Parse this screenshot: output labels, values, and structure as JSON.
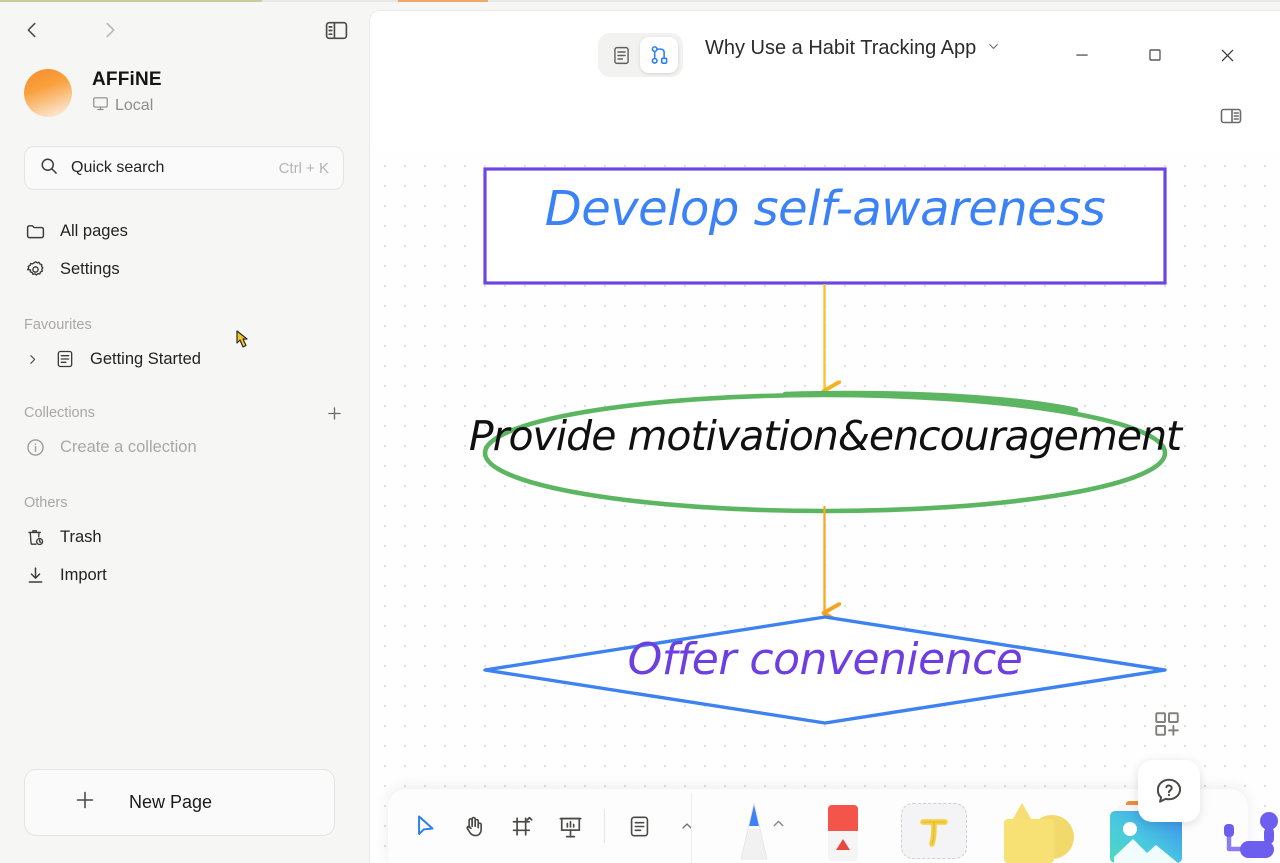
{
  "window": {
    "title": "Why Use a Habit Tracking App",
    "controls": {
      "minimize": "minimize-icon",
      "maximize": "maximize-icon",
      "close": "close-icon"
    },
    "mode_tabs": [
      {
        "name": "page-mode",
        "icon": "document-icon",
        "active": false
      },
      {
        "name": "edgeless-mode",
        "icon": "edgeless-graph-icon",
        "active": true
      }
    ]
  },
  "sidebar": {
    "nav": {
      "back": "chevron-left-icon",
      "forward": "chevron-right-icon",
      "toggle_sidebar": "sidebar-toggle-icon"
    },
    "workspace": {
      "name": "AFFiNE",
      "sync_status": "Local",
      "sync_icon": "monitor-icon"
    },
    "search": {
      "label": "Quick search",
      "shortcut": "Ctrl + K",
      "icon": "search-icon"
    },
    "items": [
      {
        "label": "All pages",
        "icon": "folder-icon"
      },
      {
        "label": "Settings",
        "icon": "gear-icon"
      }
    ],
    "favourites": {
      "title": "Favourites",
      "entries": [
        {
          "label": "Getting Started",
          "icon": "page-icon",
          "expander": "chevron-right-icon"
        }
      ]
    },
    "collections": {
      "title": "Collections",
      "add_icon": "plus-icon",
      "entries": [
        {
          "label": "Create a collection",
          "icon": "info-circle-icon"
        }
      ]
    },
    "others": {
      "title": "Others",
      "entries": [
        {
          "label": "Trash",
          "icon": "trash-clock-icon"
        },
        {
          "label": "Import",
          "icon": "import-download-icon"
        }
      ]
    },
    "new_page": {
      "label": "New Page",
      "icon": "plus-icon"
    }
  },
  "main": {
    "right_panel_toggle": "right-sidebar-toggle-icon",
    "frame_add": "add-frame-icon"
  },
  "canvas": {
    "background": "#fefefe",
    "dot_color": "#dfdfe2",
    "shapes": [
      {
        "name": "rectangle-shape",
        "type": "rectangle",
        "text": "Develop self-awareness",
        "stroke": "#6b46e5",
        "text_color": "#3b82f6",
        "fill": "#ffffff"
      },
      {
        "name": "ellipse-shape",
        "type": "ellipse",
        "text": "Provide motivation&encouragement",
        "stroke": "#5cb661",
        "text_color": "#101010",
        "fill": "#ffffff"
      },
      {
        "name": "diamond-shape",
        "type": "diamond",
        "text": "Offer convenience",
        "stroke": "#3d82ef",
        "text_color": "#6d3fe0",
        "fill": "#ffffff"
      }
    ],
    "connectors": [
      {
        "name": "connector-rect-to-ellipse",
        "color": "#fbc02d"
      },
      {
        "name": "connector-ellipse-to-diamond",
        "color": "#f9a825"
      }
    ]
  },
  "toolbar": {
    "items": [
      {
        "name": "select-tool",
        "icon": "cursor-arrow-icon",
        "active": true
      },
      {
        "name": "hand-tool",
        "icon": "hand-icon",
        "active": false
      },
      {
        "name": "frame-tool",
        "icon": "frame-icon",
        "active": false
      },
      {
        "name": "present-tool",
        "icon": "presentation-icon",
        "active": false
      },
      {
        "name": "note-tool",
        "icon": "note-document-icon",
        "active": false
      }
    ],
    "creative_tools": [
      {
        "name": "pen-tool",
        "icon": "pen-icon",
        "color": "#3b82f6"
      },
      {
        "name": "eraser-tool",
        "icon": "eraser-icon",
        "color": "#f4554a"
      },
      {
        "name": "text-tool",
        "icon": "text-T-icon",
        "color": "#f5cf42"
      },
      {
        "name": "shape-tool",
        "icon": "shapes-icon",
        "color": "#f7e174"
      },
      {
        "name": "image-tool",
        "icon": "image-icon",
        "color": "#4dd6c8"
      },
      {
        "name": "connector-tool",
        "icon": "connector-icon",
        "color": "#6d5ef0"
      }
    ],
    "help": {
      "name": "help-button",
      "icon": "question-chat-icon"
    }
  }
}
